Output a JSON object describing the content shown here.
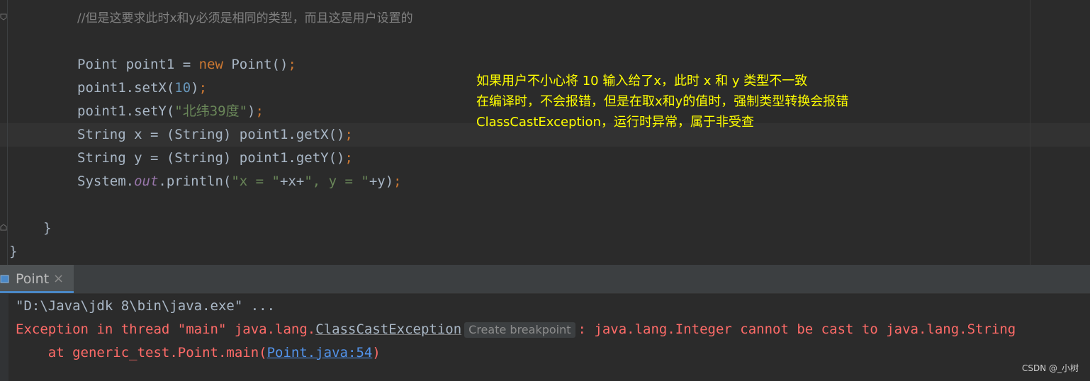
{
  "editor": {
    "comment_line": "//但是这要求此时x和y必须是相同的类型，而且这是用户设置的",
    "line_point_decl": {
      "a": "Point point1 = ",
      "kw": "new",
      "b": " Point()",
      "semi": ";"
    },
    "line_setx": {
      "a": "point1.setX(",
      "num": "10",
      "b": ")",
      "semi": ";"
    },
    "line_sety": {
      "a": "point1.setY(",
      "str": "\"北纬39度\"",
      "b": ")",
      "semi": ";"
    },
    "line_getx": {
      "a": "String x = (String) point1.getX()",
      "semi": ";"
    },
    "line_gety": {
      "a": "String y = (String) point1.getY()",
      "semi": ";"
    },
    "line_print": {
      "a": "System.",
      "field": "out",
      "b": ".println(",
      "s1": "\"x = \"",
      "c": "+x+",
      "s2": "\", y = \"",
      "d": "+y)",
      "semi": ";"
    },
    "close_method": "}",
    "close_class": "}"
  },
  "annotation": {
    "lines": [
      "如果用户不小心将 10 输入给了x，此时 x 和 y 类型不一致",
      "在编译时，不会报错，但是在取x和y的值时，强制类型转换会报错",
      "ClassCastException，运行时异常，属于非受查"
    ],
    "color": "#ffff00"
  },
  "run_panel": {
    "tab_label": "Point",
    "tab_close": "×",
    "command": "\"D:\\Java\\jdk 8\\bin\\java.exe\" ...",
    "exception_prefix": "Exception in thread \"main\" java.lang.",
    "exception_class": "ClassCastException",
    "create_breakpoint": "Create breakpoint",
    "exception_suffix": ": java.lang.Integer cannot be cast to java.lang.String",
    "stack_prefix": "    at generic_test.Point.main(",
    "stack_link": "Point.java:54",
    "stack_suffix": ")",
    "error_color": "#ff6b68"
  },
  "watermark": "CSDN @_小树"
}
